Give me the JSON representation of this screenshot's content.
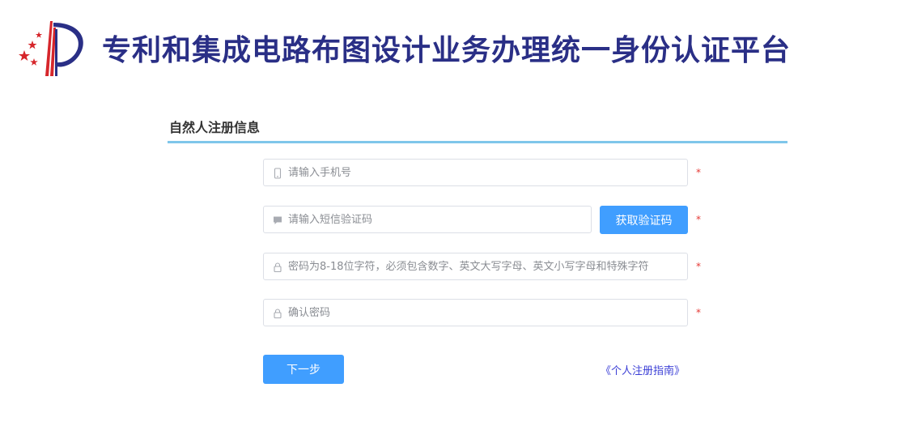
{
  "header": {
    "title": "专利和集成电路布图设计业务办理统一身份认证平台",
    "logo_icon": "cnipa-logo-icon",
    "brand_color": "#2a2f86",
    "logo_red": "#d6262b"
  },
  "section": {
    "title": "自然人注册信息",
    "accent_color": "#7fc6ea"
  },
  "form": {
    "phone": {
      "placeholder": "请输入手机号",
      "value": "",
      "icon": "mobile-phone-icon",
      "required_mark": "*"
    },
    "sms_code": {
      "placeholder": "请输入短信验证码",
      "value": "",
      "icon": "message-icon",
      "required_mark": "*",
      "button_label": "获取验证码"
    },
    "password": {
      "placeholder": "密码为8-18位字符，必须包含数字、英文大写字母、英文小写字母和特殊字符",
      "value": "",
      "icon": "lock-icon",
      "required_mark": "*"
    },
    "confirm_password": {
      "placeholder": "确认密码",
      "value": "",
      "icon": "lock-icon",
      "required_mark": "*"
    }
  },
  "actions": {
    "next_label": "下一步",
    "guide_link": "《个人注册指南》",
    "primary_color": "#409eff"
  }
}
